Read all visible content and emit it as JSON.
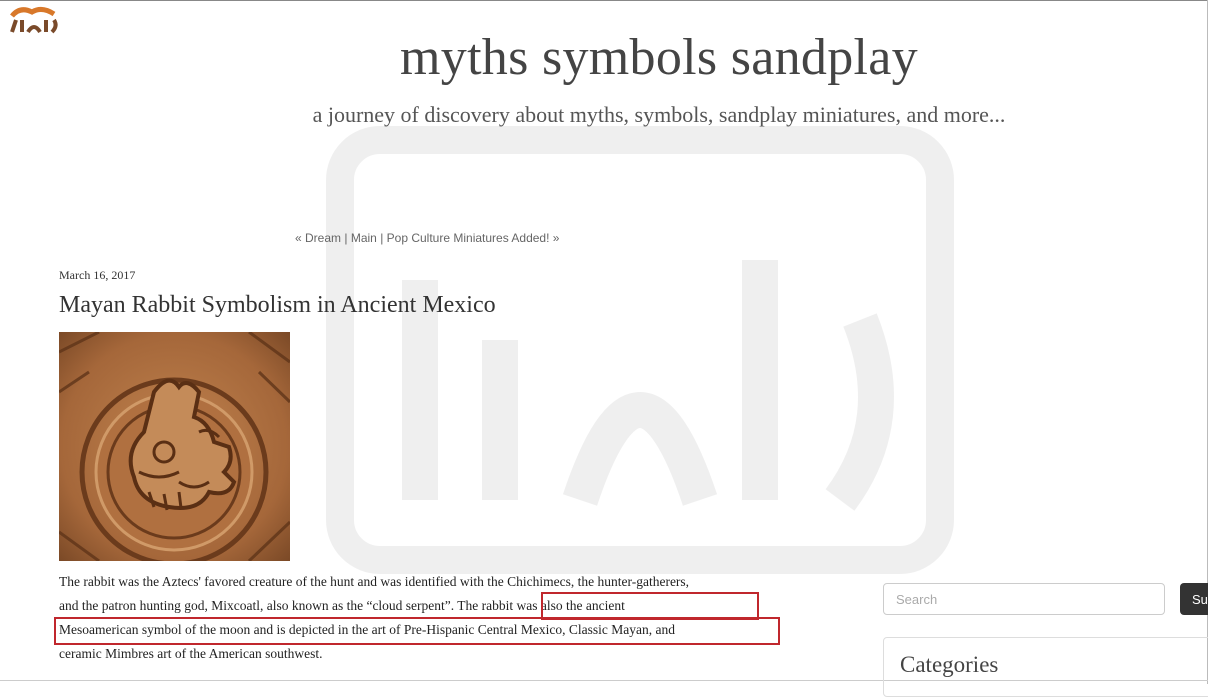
{
  "header": {
    "site_title": "myths symbols sandplay",
    "tagline": "a journey of discovery about myths, symbols, sandplay miniatures, and more..."
  },
  "post_nav": {
    "prev": "« Dream",
    "main": "Main",
    "next": "Pop Culture Miniatures Added! »",
    "separator": "|"
  },
  "post": {
    "date": "March 16, 2017",
    "title": "Mayan Rabbit Symbolism in Ancient Mexico",
    "body_lines": [
      "The rabbit was the Aztecs' favored creature of the hunt and was identified with the Chichimecs, the hunter-gatherers,",
      "and the patron hunting god, Mixcoatl, also known as the “cloud serpent”. The rabbit was also the ancient",
      "Mesoamerican symbol of the moon and is depicted in the art of Pre-Hispanic Central Mexico, Classic Mayan, and",
      "ceramic Mimbres art of the American southwest."
    ]
  },
  "sidebar": {
    "search_placeholder": "Search",
    "search_button": "Su",
    "categories_title": "Categories"
  },
  "colors": {
    "highlight_box": "#c0272d",
    "image_base": "#a86a3d"
  },
  "icons": [
    "channel-logo-icon",
    "watermark-logo"
  ]
}
